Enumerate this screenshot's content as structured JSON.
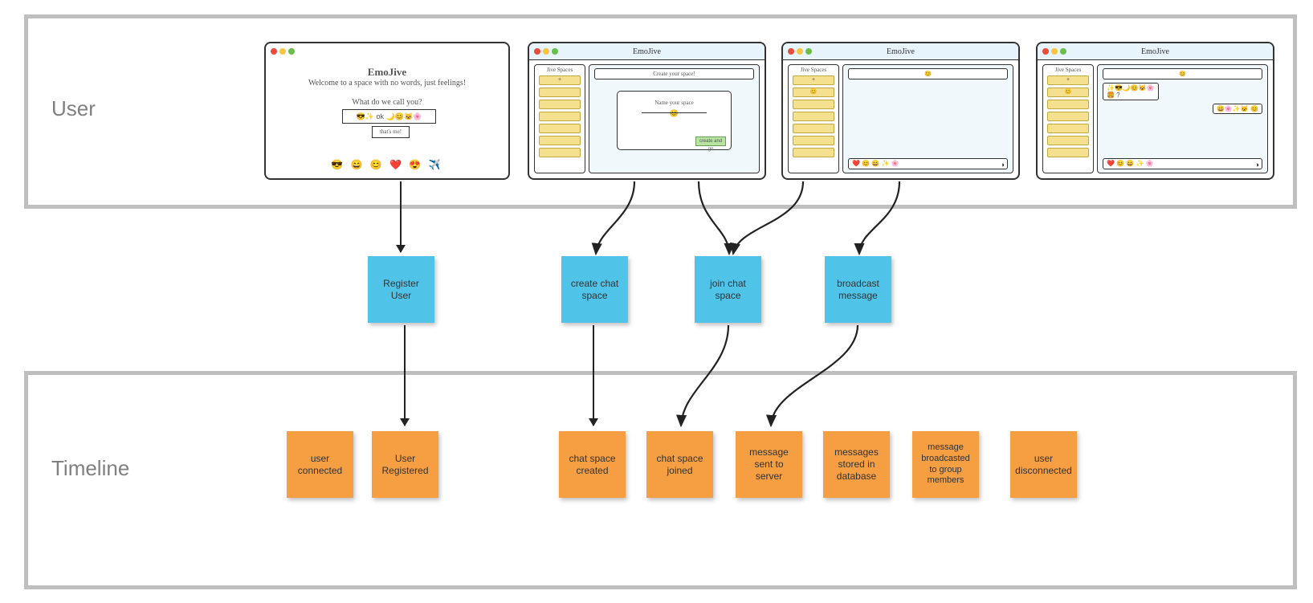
{
  "lanes": {
    "user": "User",
    "timeline": "Timeline"
  },
  "blueNotes": [
    "Register User",
    "create chat space",
    "join chat space",
    "broadcast message"
  ],
  "orangeNotes": [
    "user connected",
    "User Registered",
    "chat space created",
    "chat space joined",
    "message sent to server",
    "messages stored in database",
    "message broadcasted to group members",
    "user disconnected"
  ],
  "app": {
    "name": "EmoJive"
  },
  "mock1": {
    "title": "EmoJive",
    "subtitle": "Welcome to a space with no words, just feelings!",
    "question": "What do we call you?",
    "inputSample": "😎✨ ok 🌙😊🐱🌸",
    "button": "that's me!",
    "footerEmojis": "😎 😄 😊 ❤️ 😍 ✈️"
  },
  "mock2": {
    "sidebarTitle": "Jive Spaces",
    "plus": "+",
    "headline": "Create your space!",
    "cardTitle": "Name your space",
    "cardEmoji": "😊",
    "goBtn": "create and go"
  },
  "mock3": {
    "sidebarTitle": "Jive Spaces",
    "plus": "+",
    "headerEmoji": "😊",
    "sideSelected": "😊",
    "inputEmojis": "❤️ 😊 😄 ✨ 🌸"
  },
  "mock4": {
    "sidebarTitle": "Jive Spaces",
    "plus": "+",
    "headerEmoji": "😊",
    "sideSelected": "😊",
    "bubbleLeft": "✨😎🌙😊🐱🌸\n🍔 ?",
    "bubbleRight": "😄🌸✨🐱 😊",
    "inputEmojis": "❤️ 😊 😄 ✨ 🌸"
  }
}
